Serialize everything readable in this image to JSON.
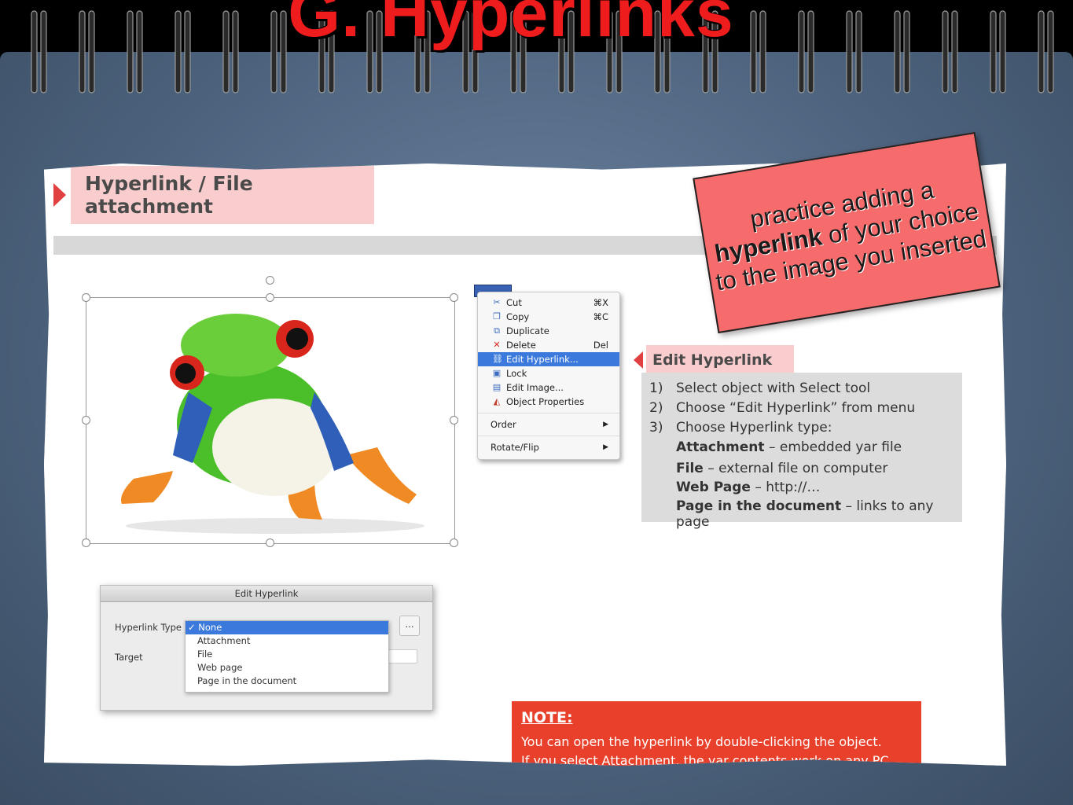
{
  "title": "G. Hyperlinks",
  "slide": {
    "heading": "Hyperlink / File attachment"
  },
  "context_menu": {
    "items": [
      {
        "label": "Cut",
        "shortcut": "⌘X",
        "icon": "scissors-icon"
      },
      {
        "label": "Copy",
        "shortcut": "⌘C",
        "icon": "copy-icon"
      },
      {
        "label": "Duplicate",
        "shortcut": "",
        "icon": "duplicate-icon"
      },
      {
        "label": "Delete",
        "shortcut": "Del",
        "icon": "delete-icon"
      },
      {
        "label": "Edit Hyperlink...",
        "shortcut": "",
        "icon": "link-icon",
        "selected": true
      },
      {
        "label": "Lock",
        "shortcut": "",
        "icon": "lock-icon"
      },
      {
        "label": "Edit Image...",
        "shortcut": "",
        "icon": "image-icon"
      },
      {
        "label": "Object Properties",
        "shortcut": "",
        "icon": "properties-icon"
      }
    ],
    "submenus": [
      {
        "label": "Order",
        "arrow": "▶"
      },
      {
        "label": "Rotate/Flip",
        "arrow": "▶"
      }
    ]
  },
  "edit_hyperlink": {
    "heading": "Edit Hyperlink",
    "steps": [
      {
        "num": "1)",
        "text": "Select object with Select tool"
      },
      {
        "num": "2)",
        "text": "Choose “Edit Hyperlink” from menu"
      },
      {
        "num": "3)",
        "text": "Choose Hyperlink type:"
      }
    ],
    "types": [
      {
        "name": "Attachment",
        "desc": " – embedded yar file"
      },
      {
        "name": "File",
        "desc": " – external file on computer"
      },
      {
        "name": "Web Page",
        "desc": " – http://…"
      },
      {
        "name": "Page in the document",
        "desc": " – links to any page"
      }
    ]
  },
  "dialog": {
    "title": "Edit Hyperlink",
    "type_label": "Hyperlink Type",
    "target_label": "Target",
    "browse": "...",
    "options": [
      {
        "label": "✓ None",
        "selected": true
      },
      {
        "label": "Attachment"
      },
      {
        "label": "File"
      },
      {
        "label": "Web page"
      },
      {
        "label": "Page in the document"
      }
    ]
  },
  "note": {
    "heading": "NOTE:",
    "line1": "You can open the hyperlink by double-clicking the object.",
    "line2": "If you select Attachment, the yar contents work on any PC."
  },
  "sticky": {
    "before": "practice adding a",
    "bold": "hyperlink",
    "after": " of your choice to the image you inserted"
  },
  "colors": {
    "title": "#ee1c1c",
    "sticky": "#f66c6c",
    "note": "#e8402a",
    "selection": "#3b79dc"
  }
}
